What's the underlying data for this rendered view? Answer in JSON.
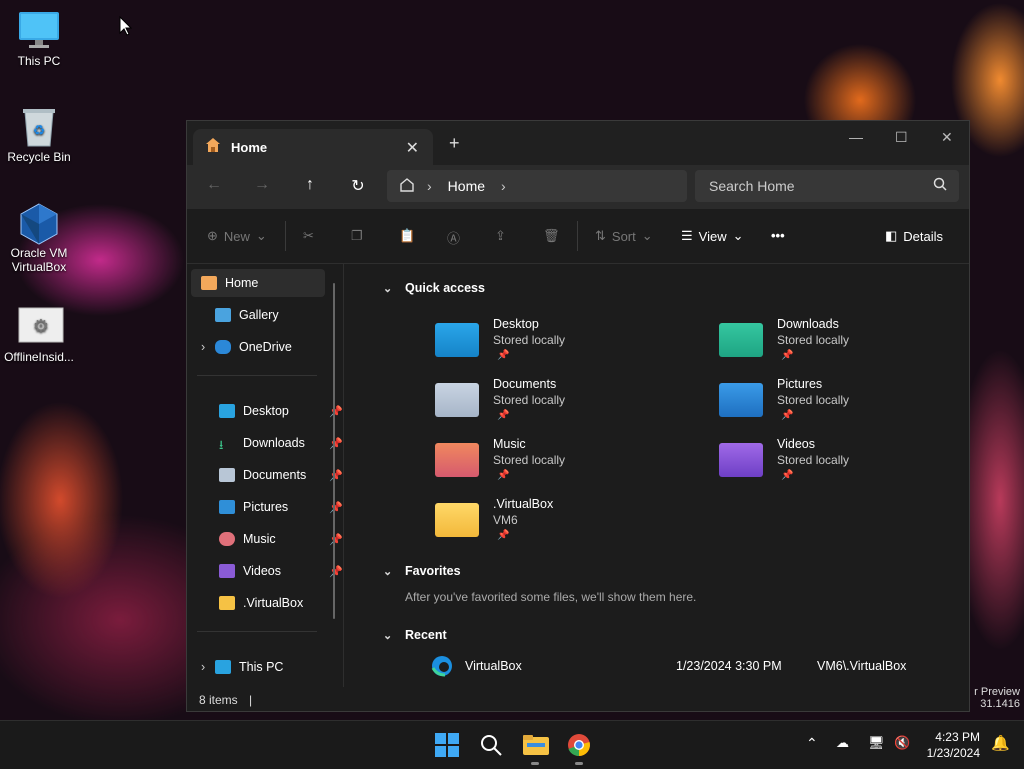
{
  "desktop": {
    "icons": [
      {
        "label": "This PC"
      },
      {
        "label": "Recycle Bin"
      },
      {
        "label": "Oracle VM VirtualBox"
      },
      {
        "label": "OfflineInsid..."
      }
    ],
    "watermark_line1": "r Preview",
    "watermark_line2": "31.1416"
  },
  "window": {
    "tab_title": "Home",
    "new_tab": "+",
    "address": {
      "segment": "Home"
    },
    "search_placeholder": "Search Home",
    "commands": {
      "new": "New",
      "sort": "Sort",
      "view": "View",
      "more": "•••",
      "details": "Details"
    },
    "sidebar": {
      "top": [
        {
          "label": "Home"
        },
        {
          "label": "Gallery"
        },
        {
          "label": "OneDrive"
        }
      ],
      "pinned": [
        {
          "label": "Desktop"
        },
        {
          "label": "Downloads"
        },
        {
          "label": "Documents"
        },
        {
          "label": "Pictures"
        },
        {
          "label": "Music"
        },
        {
          "label": "Videos"
        },
        {
          "label": ".VirtualBox"
        }
      ],
      "this_pc": "This PC"
    },
    "quick_access": {
      "title": "Quick access",
      "items": [
        {
          "name": "Desktop",
          "sub": "Stored locally"
        },
        {
          "name": "Downloads",
          "sub": "Stored locally"
        },
        {
          "name": "Documents",
          "sub": "Stored locally"
        },
        {
          "name": "Pictures",
          "sub": "Stored locally"
        },
        {
          "name": "Music",
          "sub": "Stored locally"
        },
        {
          "name": "Videos",
          "sub": "Stored locally"
        },
        {
          "name": ".VirtualBox",
          "sub": "VM6"
        }
      ]
    },
    "favorites": {
      "title": "Favorites",
      "empty_text": "After you've favorited some files, we'll show them here."
    },
    "recent": {
      "title": "Recent",
      "rows": [
        {
          "name": "VirtualBox",
          "date": "1/23/2024 3:30 PM",
          "location": "VM6\\.VirtualBox"
        }
      ]
    },
    "status": "8 items"
  },
  "taskbar": {
    "time": "4:23 PM",
    "date": "1/23/2024"
  },
  "colors": {
    "accent": "#0067c0",
    "folder_yellow": "#f6c244",
    "window_bg": "#1c1c1c"
  }
}
